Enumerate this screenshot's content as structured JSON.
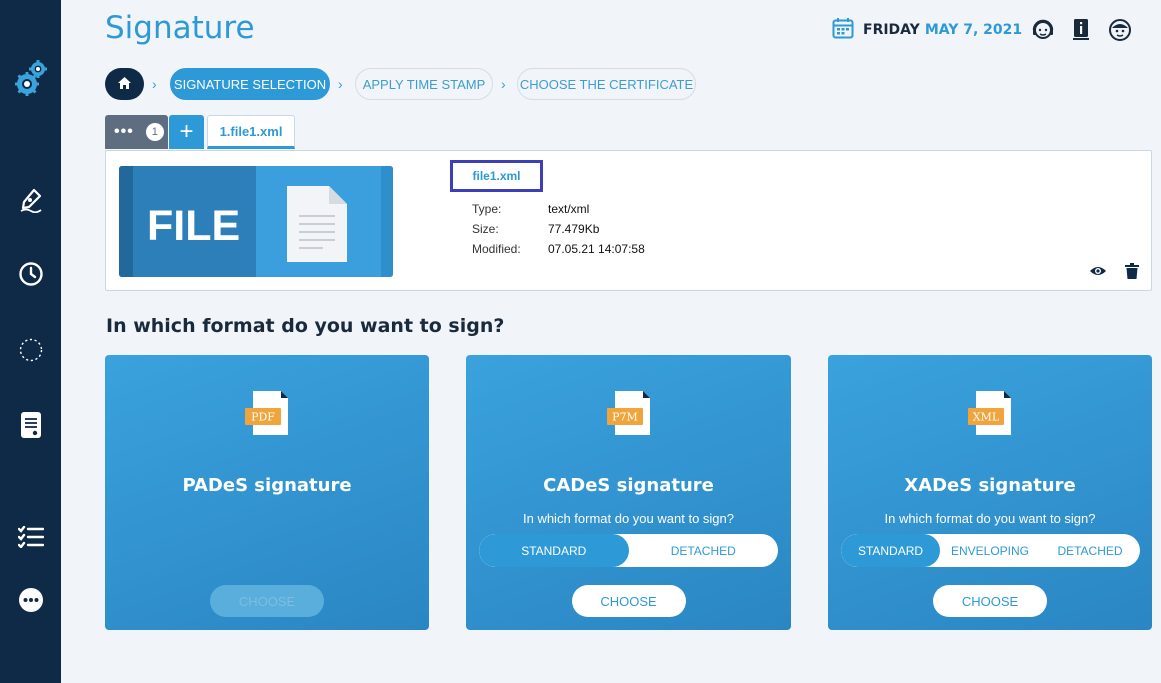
{
  "header": {
    "title": "Signature",
    "day": "FRIDAY",
    "date": "MAY 7, 2021"
  },
  "breadcrumb": {
    "steps": [
      "SIGNATURE SELECTION",
      "APPLY TIME STAMP",
      "CHOOSE THE CERTIFICATE"
    ]
  },
  "tabs": {
    "more_count": "1",
    "add_label": "+",
    "file_tab": "1.file1.xml"
  },
  "file": {
    "thumb_label": "FILE",
    "name": "file1.xml",
    "type_label": "Type:",
    "type_value": "text/xml",
    "size_label": "Size:",
    "size_value": "77.479Kb",
    "modified_label": "Modified:",
    "modified_value": "07.05.21 14:07:58"
  },
  "question": "In which format do you want to sign?",
  "cards": [
    {
      "badge": "PDF",
      "title": "PADeS signature",
      "choose": "CHOOSE"
    },
    {
      "badge": "P7M",
      "title": "CADeS signature",
      "subtitle": "In which format do you want to sign?",
      "options": [
        "STANDARD",
        "DETACHED"
      ],
      "selected": "STANDARD",
      "choose": "CHOOSE"
    },
    {
      "badge": "XML",
      "title": "XADeS signature",
      "subtitle": "In which format do you want to sign?",
      "options": [
        "STANDARD",
        "ENVELOPING",
        "DETACHED"
      ],
      "selected": "STANDARD",
      "choose": "CHOOSE"
    }
  ],
  "colors": {
    "sidebar": "#0f2a47",
    "accent": "#2d9ad7",
    "background": "#f1f4f8",
    "badge": "#f0a43c"
  }
}
